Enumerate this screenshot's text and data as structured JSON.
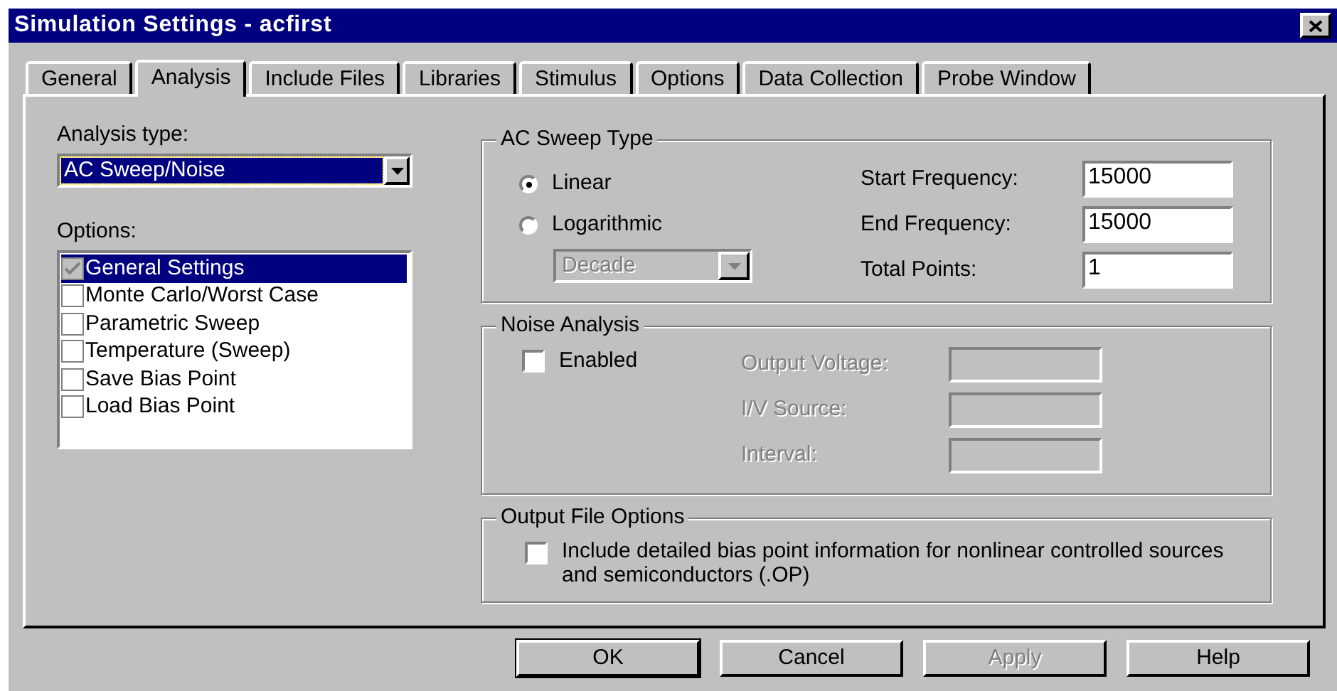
{
  "window": {
    "title": "Simulation Settings - acfirst"
  },
  "tabs": [
    {
      "label": "General",
      "selected": false
    },
    {
      "label": "Analysis",
      "selected": true
    },
    {
      "label": "Include Files",
      "selected": false
    },
    {
      "label": "Libraries",
      "selected": false
    },
    {
      "label": "Stimulus",
      "selected": false
    },
    {
      "label": "Options",
      "selected": false
    },
    {
      "label": "Data Collection",
      "selected": false
    },
    {
      "label": "Probe Window",
      "selected": false
    }
  ],
  "analysis_type": {
    "label": "Analysis type:",
    "value": "AC Sweep/Noise"
  },
  "options": {
    "label": "Options:",
    "items": [
      {
        "label": "General Settings",
        "checked": true,
        "disabled": true,
        "selected": true
      },
      {
        "label": "Monte Carlo/Worst Case",
        "checked": false,
        "disabled": false,
        "selected": false
      },
      {
        "label": "Parametric Sweep",
        "checked": false,
        "disabled": false,
        "selected": false
      },
      {
        "label": "Temperature (Sweep)",
        "checked": false,
        "disabled": false,
        "selected": false
      },
      {
        "label": "Save Bias Point",
        "checked": false,
        "disabled": false,
        "selected": false
      },
      {
        "label": "Load Bias Point",
        "checked": false,
        "disabled": false,
        "selected": false
      }
    ]
  },
  "ac_sweep": {
    "title": "AC Sweep Type",
    "radios": [
      {
        "label": "Linear",
        "selected": true
      },
      {
        "label": "Logarithmic",
        "selected": false
      }
    ],
    "scale": {
      "value": "Decade",
      "disabled": true
    },
    "fields": [
      {
        "label": "Start Frequency:",
        "value": "15000"
      },
      {
        "label": "End Frequency:",
        "value": "15000"
      },
      {
        "label": "Total Points:",
        "value": "1"
      }
    ]
  },
  "noise": {
    "title": "Noise Analysis",
    "enabled": {
      "label": "Enabled",
      "checked": false
    },
    "fields": [
      {
        "label": "Output Voltage:",
        "disabled": true
      },
      {
        "label": "I/V Source:",
        "disabled": true
      },
      {
        "label": "Interval:",
        "disabled": true
      }
    ]
  },
  "output_file_options": {
    "title": "Output File Options",
    "checkbox": {
      "label": "Include detailed bias point information for nonlinear controlled sources and semiconductors (.OP)",
      "checked": false
    }
  },
  "buttons": [
    {
      "label": "OK",
      "default": true,
      "disabled": false
    },
    {
      "label": "Cancel",
      "default": false,
      "disabled": false
    },
    {
      "label": "Apply",
      "default": false,
      "disabled": true
    },
    {
      "label": "Help",
      "default": false,
      "disabled": false
    }
  ]
}
